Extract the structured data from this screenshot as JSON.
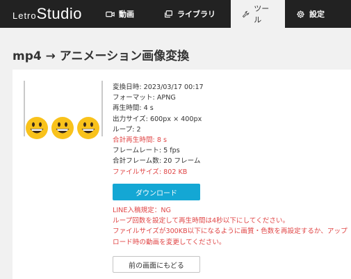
{
  "header": {
    "logo_prefix": "Letro",
    "logo_main": "Studio",
    "nav": [
      {
        "label": "動画",
        "icon": "video-icon"
      },
      {
        "label": "ライブラリ",
        "icon": "library-icon"
      },
      {
        "label": "ツール",
        "icon": "wrench-icon"
      },
      {
        "label": "設定",
        "icon": "gear-icon"
      }
    ],
    "active_tab": "ツール"
  },
  "page": {
    "title": "mp4 → アニメーション画像変換"
  },
  "result": {
    "details": [
      {
        "text": "変換日時: 2023/03/17 00:17",
        "highlight": false
      },
      {
        "text": "フォーマット: APNG",
        "highlight": false
      },
      {
        "text": "再生時間: 4 s",
        "highlight": false
      },
      {
        "text": "出力サイズ: 600px × 400px",
        "highlight": false
      },
      {
        "text": "ループ: 2",
        "highlight": false
      },
      {
        "text": "合計再生時間: 8 s",
        "highlight": true
      },
      {
        "text": "フレームレート: 5 fps",
        "highlight": false
      },
      {
        "text": "合計フレーム数: 20 フレーム",
        "highlight": false
      },
      {
        "text": "ファイルサイズ: 802 KB",
        "highlight": true
      }
    ],
    "download_label": "ダウンロード",
    "warnings": [
      "LINE入稿規定：NG",
      "ループ回数を設定して再生時間は4秒以下にしてください。",
      "ファイルサイズが300KB以下になるように画質・色数を再設定するか、アップロード時の動画を変更してください。"
    ],
    "back_label": "前の画面にもどる"
  },
  "colors": {
    "header_bg": "#222222",
    "accent": "#14a7d4",
    "warning": "#e04646",
    "page_bg": "#f1f1f1"
  }
}
